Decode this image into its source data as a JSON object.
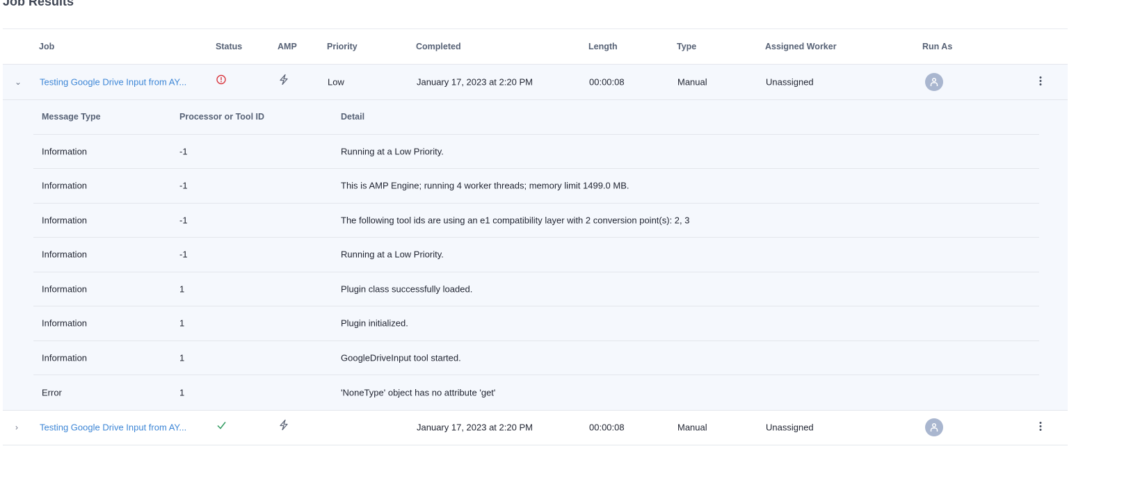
{
  "title": "Job Results",
  "columns": [
    "Job",
    "Status",
    "AMP",
    "Priority",
    "Completed",
    "Length",
    "Type",
    "Assigned Worker",
    "Run As"
  ],
  "jobs": [
    {
      "name": "Testing Google Drive Input from AY...",
      "status": "error",
      "priority": "Low",
      "completed": "January 17, 2023 at 2:20 PM",
      "length": "00:00:08",
      "type": "Manual",
      "worker": "Unassigned",
      "expanded": true
    },
    {
      "name": "Testing Google Drive Input from AY...",
      "status": "success",
      "priority": "",
      "completed": "January 17, 2023 at 2:20 PM",
      "length": "00:00:08",
      "type": "Manual",
      "worker": "Unassigned",
      "expanded": false
    }
  ],
  "messages": {
    "columns": [
      "Message Type",
      "Processor or Tool ID",
      "Detail"
    ],
    "rows": [
      {
        "type": "Information",
        "id": "-1",
        "detail": "Running at a Low Priority."
      },
      {
        "type": "Information",
        "id": "-1",
        "detail": "This is AMP Engine; running 4 worker threads; memory limit 1499.0 MB."
      },
      {
        "type": "Information",
        "id": "-1",
        "detail": "The following tool ids are using an e1 compatibility layer with 2 conversion point(s): 2, 3"
      },
      {
        "type": "Information",
        "id": "-1",
        "detail": "Running at a Low Priority."
      },
      {
        "type": "Information",
        "id": "1",
        "detail": "Plugin class successfully loaded."
      },
      {
        "type": "Information",
        "id": "1",
        "detail": "Plugin initialized."
      },
      {
        "type": "Information",
        "id": "1",
        "detail": "GoogleDriveInput tool started."
      },
      {
        "type": "Error",
        "id": "1",
        "detail": "'NoneType' object has no attribute 'get'"
      }
    ]
  },
  "colors": {
    "link": "#3d86d6",
    "error": "#d9363e",
    "success": "#2e9a5e",
    "expanded_bg": "#f5f8fd"
  }
}
